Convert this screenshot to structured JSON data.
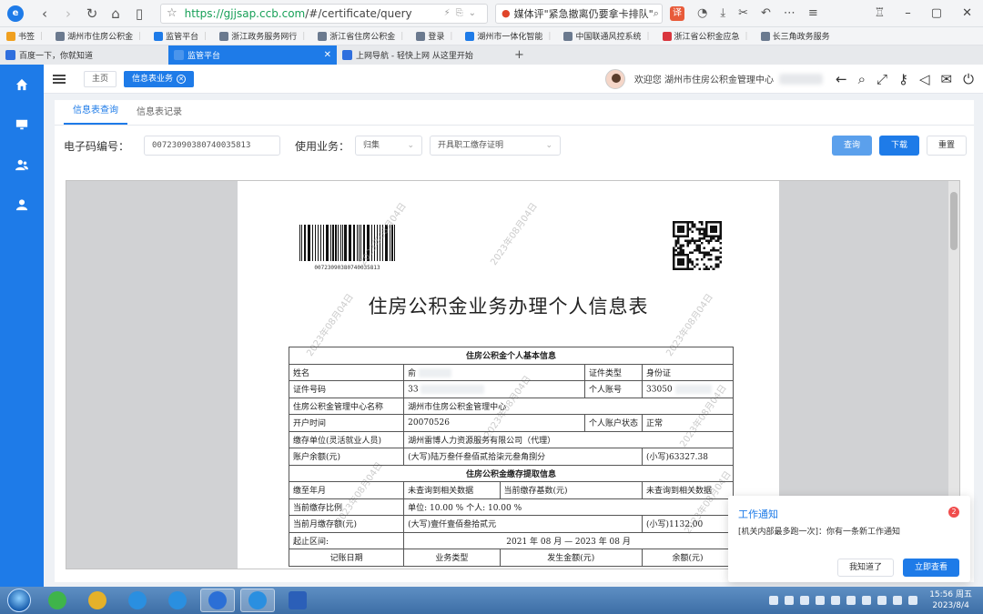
{
  "browser": {
    "url_prefix": "https://",
    "url_host": "gjjsap.ccb.com",
    "url_path": "/#/certificate/query",
    "search_text": "媒体评\"紧急撤离仍要拿卡排队\"",
    "logo_letter": "e"
  },
  "bookmarks": [
    {
      "label": "书签",
      "color": "#f0a020"
    },
    {
      "label": "湖州市住房公积金",
      "color": "#6b7a8f"
    },
    {
      "label": "监管平台",
      "color": "#1e7be8"
    },
    {
      "label": "浙江政务服务网行",
      "color": "#6b7a8f"
    },
    {
      "label": "浙江省住房公积金",
      "color": "#6b7a8f"
    },
    {
      "label": "登录",
      "color": "#6b7a8f"
    },
    {
      "label": "湖州市一体化智能",
      "color": "#1e7be8"
    },
    {
      "label": "中国联通风控系统",
      "color": "#6b7a8f"
    },
    {
      "label": "浙江省公积金应急",
      "color": "#d9363e"
    },
    {
      "label": "长三角政务服务",
      "color": "#6b7a8f"
    }
  ],
  "tabs": [
    {
      "label": "百度一下，你就知道",
      "color": "#2f6fde",
      "active": false
    },
    {
      "label": "监管平台",
      "color": "#ffffff",
      "active": true
    },
    {
      "label": "上网导航 - 轻快上网 从这里开始",
      "color": "#2f6fde",
      "active": false
    }
  ],
  "topbar": {
    "home_tab": "主页",
    "active_tab": "信息表业务",
    "welcome": "欢迎您 湖州市住房公积金管理中心"
  },
  "sub_tabs": [
    "信息表查询",
    "信息表记录"
  ],
  "query": {
    "code_label": "电子码编号：",
    "code_value": "00723090380740035813",
    "biz_label": "使用业务：",
    "biz_select": "归集",
    "purpose_select": "开具职工缴存证明",
    "btn_query": "查询",
    "btn_download": "下载",
    "btn_reset": "重置"
  },
  "document": {
    "barcode_number": "00723090380740035813",
    "title": "住房公积金业务办理个人信息表",
    "watermark": "2023年08月04日",
    "section1": "住房公积金个人基本信息",
    "name_label": "姓名",
    "name_value": "俞",
    "id_type_label": "证件类型",
    "id_type_value": "身份证",
    "id_no_label": "证件号码",
    "id_no_value": "33",
    "account_label": "个人账号",
    "account_value": "33050",
    "center_label": "住房公积金管理中心名称",
    "center_value": "湖州市住房公积金管理中心",
    "open_label": "开户时间",
    "open_value": "20070526",
    "status_label": "个人账户状态",
    "status_value": "正常",
    "unit_label": "缴存单位(灵活就业人员)",
    "unit_value": "湖州雷博人力资源服务有限公司（代理）",
    "balance_label": "账户余额(元)",
    "balance_words": "(大写)陆万叁仟叁佰贰拾柒元叁角捌分",
    "balance_num": "(小写)63327.38",
    "section2": "住房公积金缴存提取信息",
    "paid_to_label": "缴至年月",
    "paid_to_value": "未查询到相关数据",
    "base_label": "当前缴存基数(元)",
    "base_value": "未查询到相关数据",
    "ratio_label": "当前缴存比例",
    "ratio_value": "单位: 10.00 % 个人: 10.00 %",
    "monthly_label": "当前月缴存额(元)",
    "monthly_words": "(大写)壹仟壹佰叁拾贰元",
    "monthly_num": "(小写)1132.00",
    "range_label": "起止区间:",
    "range_value": "2021 年 08 月 — 2023 年 08 月",
    "col_date": "记账日期",
    "col_type": "业务类型",
    "col_amount": "发生金额(元)",
    "col_balance": "余额(元)"
  },
  "notification": {
    "title": "工作通知",
    "badge": "2",
    "message": "[机关内部最多跑一次]：你有一条新工作通知",
    "btn_ack": "我知道了",
    "btn_view": "立即查看"
  },
  "taskbar": {
    "apps": [
      {
        "name": "360-safe-icon",
        "color": "#3fb44a"
      },
      {
        "name": "chrome-icon",
        "color": "#e5b12a"
      },
      {
        "name": "ie-icon-1",
        "color": "#2a8fe0"
      },
      {
        "name": "ie-icon-2",
        "color": "#2a8fe0"
      },
      {
        "name": "browser-icon",
        "color": "#2b6fd6"
      },
      {
        "name": "shield-icon",
        "color": "#2a8fe0"
      },
      {
        "name": "word-icon",
        "color": "#2b5fb8"
      }
    ],
    "time": "15:56 周五",
    "date": "2023/8/4"
  },
  "colors": {
    "accent": "#1e7be8",
    "danger": "#f04d4d"
  }
}
